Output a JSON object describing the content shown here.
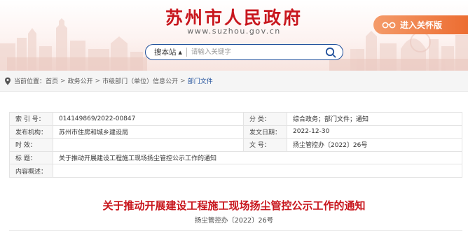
{
  "header": {
    "title": "苏州市人民政府",
    "url": "www.suzhou.gov.cn",
    "care_mode_label": "进入关怀版",
    "care_mode_icon": "glasses-icon"
  },
  "search": {
    "scope_label": "搜本站",
    "placeholder": "请输入关键字",
    "icon": "search-icon"
  },
  "breadcrumb": {
    "prefix": "当前位置：",
    "items": [
      "首页",
      "政务公开",
      "市级部门（单位）信息公开",
      "部门文件"
    ],
    "separator": ">"
  },
  "meta": {
    "index_label": "索  引  号：",
    "index_value": "014149869/2022-00847",
    "category_label": "分      类：",
    "category_value": "综合政务；部门文件；通知",
    "publisher_label": "发布机构：",
    "publisher_value": "苏州市住房和城乡建设局",
    "date_label": "发文日期：",
    "date_value": "2022-12-30",
    "effect_label": "时      效：",
    "effect_value": "",
    "docno_label": "文      号：",
    "docno_value": "扬尘管控办〔2022〕26号",
    "title_label": "标      题：",
    "title_value": "关于推动开展建设工程施工现场扬尘管控公示工作的通知",
    "summary_label": "内容概述：",
    "summary_value": ""
  },
  "document": {
    "title": "关于推动开展建设工程施工现场扬尘管控公示工作的通知",
    "number": "扬尘管控办〔2022〕26号"
  },
  "colors": {
    "brand_red": "#c8161d",
    "care_orange": "#ec6b2f",
    "search_blue": "#1f4f9b"
  }
}
